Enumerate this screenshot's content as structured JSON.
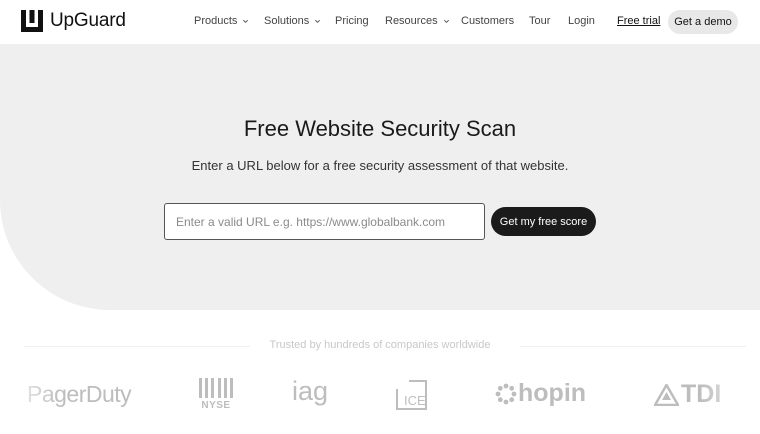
{
  "brand": {
    "name": "UpGuard"
  },
  "nav": {
    "items": [
      {
        "label": "Products",
        "has_dropdown": true
      },
      {
        "label": "Solutions",
        "has_dropdown": true
      },
      {
        "label": "Pricing",
        "has_dropdown": false
      },
      {
        "label": "Resources",
        "has_dropdown": true
      },
      {
        "label": "Customers",
        "has_dropdown": false
      },
      {
        "label": "Tour",
        "has_dropdown": false
      },
      {
        "label": "Login",
        "has_dropdown": false
      }
    ],
    "free_trial": "Free trial",
    "demo": "Get a demo"
  },
  "hero": {
    "title": "Free Website Security Scan",
    "subtitle": "Enter a URL below for a free security assessment of that website.",
    "input_value": "",
    "input_placeholder": "Enter a valid URL e.g. https://www.globalbank.com",
    "button": "Get my free score"
  },
  "trusted": {
    "heading": "Trusted by hundreds of companies worldwide",
    "logos": [
      {
        "name": "PagerDuty",
        "icon": "pagerduty-logo"
      },
      {
        "name": "NYSE",
        "icon": "nyse-logo"
      },
      {
        "name": "iag",
        "icon": "iag-logo"
      },
      {
        "name": "ICE",
        "icon": "ice-logo"
      },
      {
        "name": "hopin",
        "icon": "hopin-logo"
      },
      {
        "name": "TDI",
        "icon": "tdi-logo"
      }
    ]
  },
  "colors": {
    "hero_bg": "#efefef",
    "primary_button": "#1b1b1b",
    "secondary_button": "#e8e8e8",
    "logo_gray": "#bdbdbd"
  }
}
